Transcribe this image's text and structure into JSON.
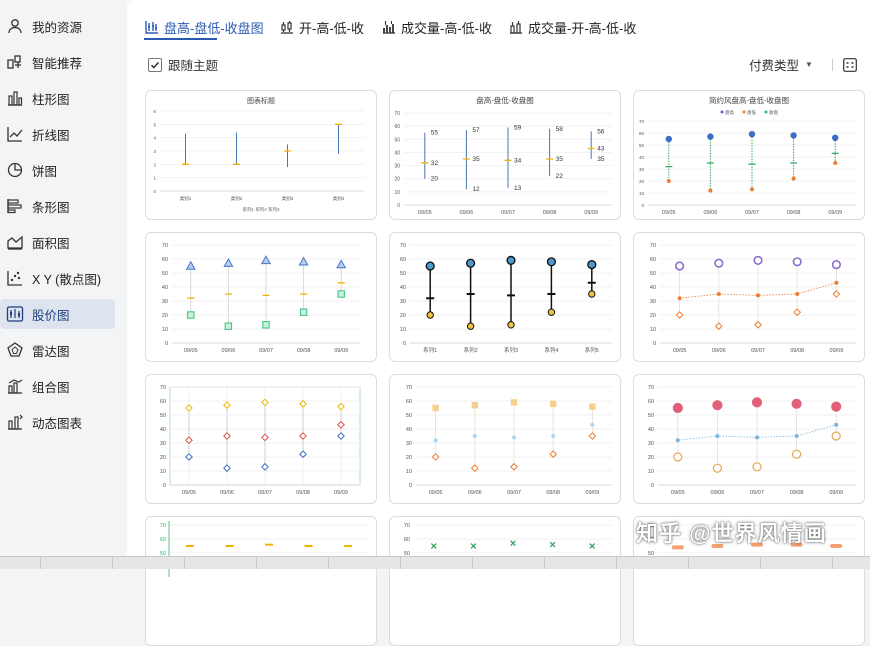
{
  "sidebar": {
    "items": [
      {
        "label": "我的资源",
        "icon": "user-icon"
      },
      {
        "label": "智能推荐",
        "icon": "smart-recommend-icon"
      },
      {
        "label": "柱形图",
        "icon": "bar-chart-icon"
      },
      {
        "label": "折线图",
        "icon": "line-chart-icon"
      },
      {
        "label": "饼图",
        "icon": "pie-chart-icon"
      },
      {
        "label": "条形图",
        "icon": "horizontal-bar-icon"
      },
      {
        "label": "面积图",
        "icon": "area-chart-icon"
      },
      {
        "label": "X Y (散点图)",
        "icon": "scatter-chart-icon"
      },
      {
        "label": "股价图",
        "icon": "stock-chart-icon"
      },
      {
        "label": "雷达图",
        "icon": "radar-chart-icon"
      },
      {
        "label": "组合图",
        "icon": "combo-chart-icon"
      },
      {
        "label": "动态图表",
        "icon": "dynamic-chart-icon"
      }
    ],
    "active_index": 8
  },
  "tabs": [
    {
      "label": "盘高-盘低-收盘图"
    },
    {
      "label": "开-高-低-收"
    },
    {
      "label": "成交量-高-低-收"
    },
    {
      "label": "成交量-开-高-低-收"
    }
  ],
  "toolbar": {
    "follow_theme": "跟随主题",
    "pay_type": "付费类型"
  },
  "colors": {
    "accent": "#2b5bb0",
    "blue": "#4472c4",
    "orange": "#ed7d31",
    "yellow": "#f0b400",
    "green": "#38b26a",
    "purple": "#8e6bd0"
  },
  "watermark": "知乎 @世界风情画",
  "chart_data": [
    {
      "type": "table",
      "title": "图表标题",
      "categories": [
        "类别1",
        "类别2",
        "类别3",
        "类别4"
      ],
      "series": [
        {
          "name": "系列1",
          "values": [
            4.3,
            4.4,
            3.5,
            5.0
          ]
        },
        {
          "name": "系列2",
          "values": [
            2.0,
            2.0,
            1.8,
            2.8
          ]
        },
        {
          "name": "系列3",
          "values": [
            2.0,
            2.0,
            3.0,
            5.0
          ]
        }
      ],
      "ylim": [
        0,
        6
      ],
      "yticks": [
        "0",
        "1",
        "2",
        "3",
        "4",
        "5",
        "6"
      ]
    },
    {
      "type": "table",
      "title": "盘高-盘低-收盘图",
      "categories": [
        "09/05",
        "09/06",
        "09/07",
        "09/08",
        "09/09"
      ],
      "high": [
        55,
        57,
        59,
        58,
        56
      ],
      "low": [
        20,
        12,
        13,
        22,
        35
      ],
      "close": [
        32,
        35,
        34,
        35,
        43
      ],
      "ylim": [
        0,
        70
      ],
      "yticks": [
        "0",
        "10",
        "20",
        "30",
        "40",
        "50",
        "60",
        "70"
      ],
      "labels": {
        "high": [
          "55",
          "57",
          "59",
          "58",
          "56"
        ],
        "low": [
          "20",
          "12",
          "13",
          "22",
          "35"
        ],
        "close": [
          "32",
          "35",
          "34",
          "35",
          "43"
        ]
      }
    },
    {
      "type": "table",
      "title": "简约风盘高-盘低-收盘图",
      "legend": [
        "盘高",
        "盘低",
        "收盘"
      ],
      "categories": [
        "09/05",
        "09/06",
        "09/07",
        "09/08",
        "09/09"
      ],
      "high": [
        55,
        57,
        59,
        58,
        56
      ],
      "low": [
        20,
        12,
        13,
        22,
        35
      ],
      "close": [
        32,
        35,
        34,
        35,
        43
      ],
      "ylim": [
        0,
        70
      ],
      "yticks": [
        "0",
        "10",
        "20",
        "30",
        "40",
        "50",
        "60",
        "70"
      ]
    },
    {
      "type": "table",
      "categories": [
        "09/05",
        "09/06",
        "09/07",
        "09/08",
        "09/09"
      ],
      "high": [
        55,
        57,
        59,
        58,
        56
      ],
      "low": [
        20,
        12,
        13,
        22,
        35
      ],
      "close": [
        32,
        35,
        34,
        35,
        43
      ],
      "ylim": [
        0,
        70
      ],
      "yticks": [
        "0",
        "10",
        "20",
        "30",
        "40",
        "50",
        "60",
        "70"
      ]
    },
    {
      "type": "table",
      "categories": [
        "系列1",
        "系列2",
        "系列3",
        "系列4",
        "系列5"
      ],
      "high": [
        55,
        57,
        59,
        58,
        56
      ],
      "low": [
        20,
        12,
        13,
        22,
        35
      ],
      "close": [
        32,
        35,
        34,
        35,
        43
      ],
      "ylim": [
        0,
        70
      ],
      "yticks": [
        "0",
        "10",
        "20",
        "30",
        "40",
        "50",
        "60",
        "70"
      ]
    },
    {
      "type": "table",
      "categories": [
        "09/05",
        "09/06",
        "09/07",
        "09/08",
        "09/09"
      ],
      "high": [
        55,
        57,
        59,
        58,
        56
      ],
      "low": [
        20,
        12,
        13,
        22,
        35
      ],
      "close": [
        32,
        35,
        34,
        35,
        43
      ],
      "ylim": [
        0,
        70
      ],
      "yticks": [
        "0",
        "10",
        "20",
        "30",
        "40",
        "50",
        "60",
        "70"
      ]
    },
    {
      "type": "table",
      "categories": [
        "09/05",
        "09/06",
        "09/07",
        "09/08",
        "09/09"
      ],
      "high": [
        55,
        57,
        59,
        58,
        56
      ],
      "low": [
        20,
        12,
        13,
        22,
        35
      ],
      "close": [
        32,
        35,
        34,
        35,
        43
      ],
      "ylim": [
        0,
        70
      ],
      "yticks": [
        "0",
        "10",
        "20",
        "30",
        "40",
        "50",
        "60",
        "70"
      ]
    },
    {
      "type": "table",
      "categories": [
        "09/05",
        "09/06",
        "09/07",
        "09/08",
        "09/09"
      ],
      "high": [
        55,
        57,
        59,
        58,
        56
      ],
      "low": [
        20,
        12,
        13,
        22,
        35
      ],
      "close": [
        32,
        35,
        34,
        35,
        43
      ],
      "ylim": [
        0,
        70
      ],
      "yticks": [
        "0",
        "10",
        "20",
        "30",
        "40",
        "50",
        "60",
        "70"
      ]
    },
    {
      "type": "table",
      "categories": [
        "09/05",
        "09/06",
        "09/07",
        "09/08",
        "09/09"
      ],
      "high": [
        55,
        57,
        59,
        58,
        56
      ],
      "low": [
        20,
        12,
        13,
        22,
        35
      ],
      "close": [
        32,
        35,
        34,
        35,
        43
      ],
      "ylim": [
        0,
        70
      ],
      "yticks": [
        "0",
        "10",
        "20",
        "30",
        "40",
        "50",
        "60",
        "70"
      ]
    },
    {
      "type": "table",
      "categories": [
        "",
        "",
        "",
        "",
        ""
      ],
      "high": [
        55,
        55,
        56,
        55,
        55
      ],
      "ylim": [
        0,
        70
      ],
      "yticks": [
        "70",
        "60",
        "50"
      ]
    },
    {
      "type": "table",
      "categories": [
        "",
        "",
        "",
        "",
        ""
      ],
      "high": [
        55,
        55,
        57,
        56,
        55
      ],
      "ylim": [
        0,
        70
      ],
      "yticks": [
        "70",
        "60",
        "50"
      ]
    },
    {
      "type": "table",
      "categories": [
        "",
        "",
        "",
        "",
        ""
      ],
      "high": [
        54,
        55,
        56,
        56,
        55
      ],
      "ylim": [
        0,
        70
      ],
      "yticks": [
        "70",
        "60",
        "50"
      ]
    }
  ]
}
